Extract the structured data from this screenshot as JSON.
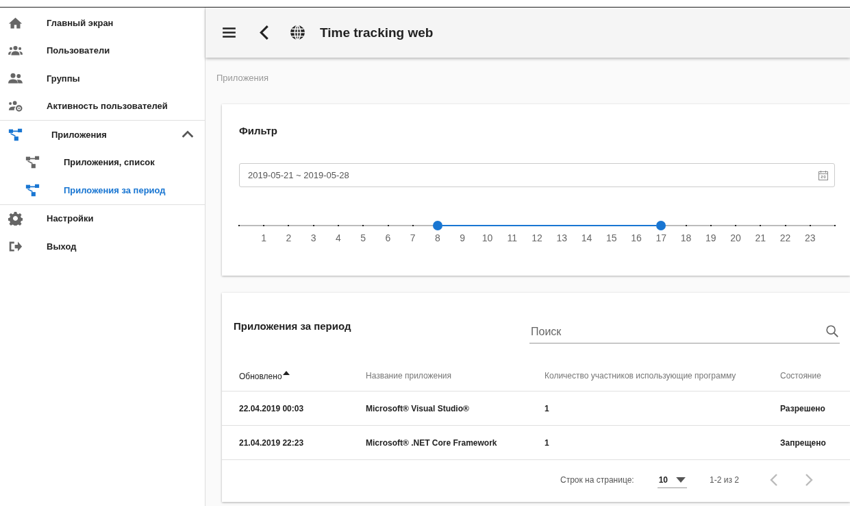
{
  "sidebar": {
    "items": [
      {
        "label": "Главный экран",
        "selected": false
      },
      {
        "label": "Пользователи",
        "selected": false
      },
      {
        "label": "Группы",
        "selected": false
      },
      {
        "label": "Активность пользователей",
        "selected": false
      },
      {
        "label": "Приложения",
        "selected": false,
        "expanded": true,
        "children": [
          {
            "label": "Приложения, список",
            "selected": false
          },
          {
            "label": "Приложения за период",
            "selected": true
          }
        ]
      },
      {
        "label": "Настройки",
        "selected": false
      },
      {
        "label": "Выход",
        "selected": false
      }
    ]
  },
  "header": {
    "title": "Time tracking web"
  },
  "breadcrumb": "Приложения",
  "filter": {
    "title": "Фильтр",
    "date_range": "2019-05-21 ~ 2019-05-28",
    "slider": {
      "labels": [
        "1",
        "2",
        "3",
        "4",
        "5",
        "6",
        "7",
        "8",
        "9",
        "10",
        "11",
        "12",
        "13",
        "14",
        "15",
        "16",
        "17",
        "18",
        "19",
        "20",
        "21",
        "22",
        "23"
      ],
      "thumbs": [
        {
          "level": 0.3333
        },
        {
          "level": 0.7083
        }
      ]
    }
  },
  "table": {
    "title": "Приложения за период",
    "search": {
      "placeholder": "Поиск"
    },
    "columns": [
      {
        "label": "Обновлено",
        "sorted": true
      },
      {
        "label": "Название приложения",
        "sorted": false
      },
      {
        "label": "Количество участников использующие программу",
        "sorted": false
      },
      {
        "label": "Состояние",
        "sorted": false
      }
    ],
    "rows": [
      [
        "22.04.2019 00:03",
        "Microsoft® Visual Studio®",
        "1",
        "Разрешено"
      ],
      [
        "21.04.2019 22:23",
        "Microsoft® .NET Core Framework",
        "1",
        "Запрещено"
      ]
    ],
    "footer": {
      "rows_per_page_label": "Строк на странице:",
      "rows_per_page": "10",
      "range": "1-2 из 2",
      "prev_disabled": true,
      "next_disabled": true
    }
  }
}
